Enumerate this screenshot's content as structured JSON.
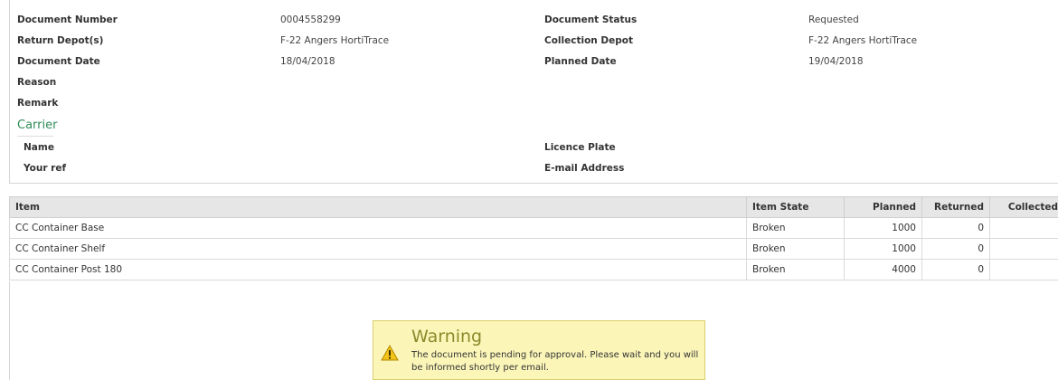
{
  "header": {
    "document_number_label": "Document Number",
    "document_number": "0004558299",
    "document_status_label": "Document Status",
    "document_status": "Requested",
    "return_depot_label": "Return Depot(s)",
    "return_depot": "F-22 Angers HortiTrace",
    "collection_depot_label": "Collection Depot",
    "collection_depot": "F-22 Angers HortiTrace",
    "document_date_label": "Document Date",
    "document_date": "18/04/2018",
    "planned_date_label": "Planned Date",
    "planned_date": "19/04/2018",
    "reason_label": "Reason",
    "remark_label": "Remark"
  },
  "carrier": {
    "title": "Carrier",
    "name_label": "Name",
    "licence_plate_label": "Licence Plate",
    "your_ref_label": "Your ref",
    "email_label": "E-mail Address"
  },
  "table": {
    "headers": [
      "Item",
      "Item State",
      "Planned",
      "Returned",
      "Collected"
    ],
    "rows": [
      {
        "item": "CC Container Base",
        "state": "Broken",
        "planned": "1000",
        "returned": "0",
        "collected": ""
      },
      {
        "item": "CC Container Shelf",
        "state": "Broken",
        "planned": "1000",
        "returned": "0",
        "collected": ""
      },
      {
        "item": "CC Container Post 180",
        "state": "Broken",
        "planned": "4000",
        "returned": "0",
        "collected": ""
      }
    ]
  },
  "warning": {
    "icon": "warning-triangle-icon",
    "title": "Warning",
    "message": "The document is pending for approval. Please wait and you will be informed shortly per email."
  },
  "colors": {
    "carrier_title": "#2e8b57",
    "table_header_bg": "#e6e6e6",
    "warning_bg": "#fbf6b8",
    "warning_title": "#8c8a2c"
  }
}
